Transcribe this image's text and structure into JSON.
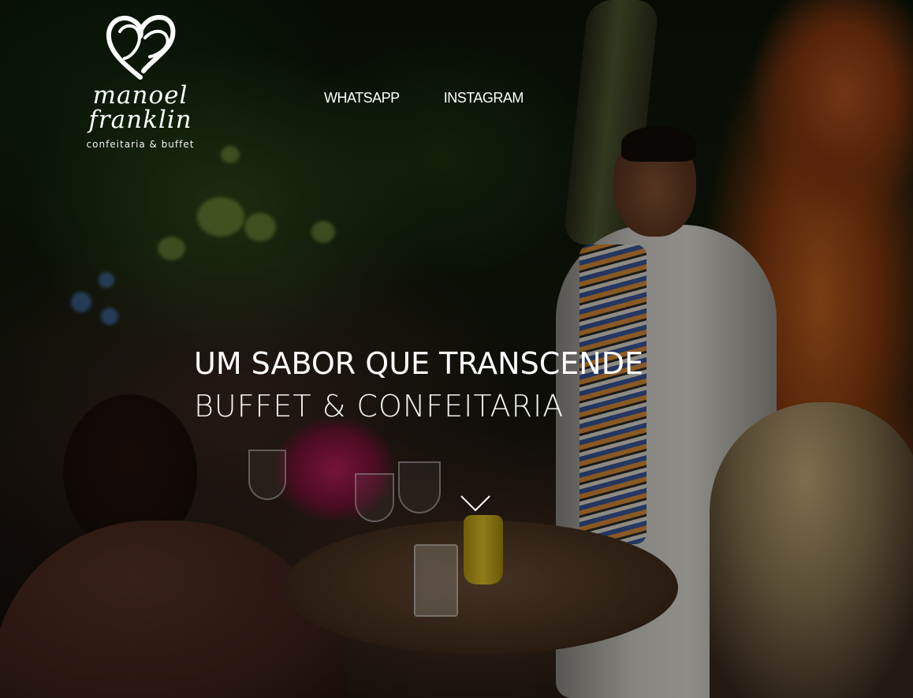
{
  "brand": {
    "logo_script": "manoel franklin",
    "logo_subtitle": "confeitaria & buffet"
  },
  "nav": {
    "items": [
      {
        "label": "WHATSAPP"
      },
      {
        "label": "INSTAGRAM"
      }
    ]
  },
  "hero": {
    "headline": "UM SABOR QUE TRANSCENDE",
    "subheadline": "BUFFET & CONFEITARIA"
  },
  "icons": {
    "logo": "heart-logo-icon",
    "scroll": "chevron-down-icon"
  },
  "colors": {
    "text": "#ffffff"
  }
}
